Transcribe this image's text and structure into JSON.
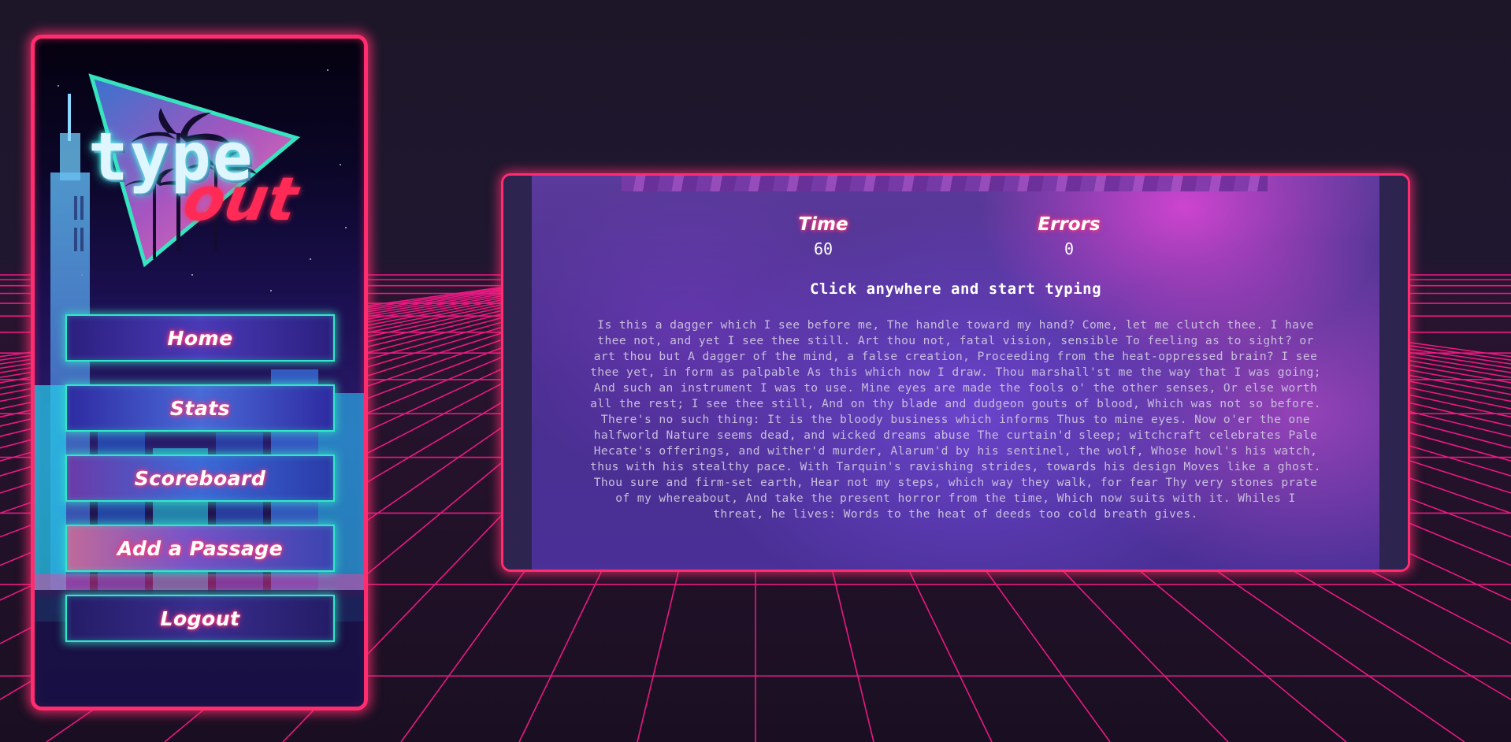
{
  "logo": {
    "word1": "type",
    "word2": "out"
  },
  "nav": {
    "items": [
      {
        "label": "Home"
      },
      {
        "label": "Stats"
      },
      {
        "label": "Scoreboard"
      },
      {
        "label": "Add a Passage"
      },
      {
        "label": "Logout"
      }
    ]
  },
  "stats": {
    "time_label": "Time",
    "time_value": "60",
    "errors_label": "Errors",
    "errors_value": "0"
  },
  "prompt": "Click anywhere and start typing",
  "passage": "Is this a dagger which I see before me, The handle toward my hand? Come, let me clutch thee. I have thee not, and yet I see thee still. Art thou not, fatal vision, sensible To feeling as to sight? or art thou but A dagger of the mind, a false creation, Proceeding from the heat-oppressed brain? I see thee yet, in form as palpable As this which now I draw. Thou marshall'st me the way that I was going; And such an instrument I was to use. Mine eyes are made the fools o' the other senses, Or else worth all the rest; I see thee still, And on thy blade and dudgeon gouts of blood, Which was not so before. There's no such thing: It is the bloody business which informs Thus to mine eyes. Now o'er the one halfworld Nature seems dead, and wicked dreams abuse The curtain'd sleep; witchcraft celebrates Pale Hecate's offerings, and wither'd murder, Alarum'd by his sentinel, the wolf, Whose howl's his watch, thus with his stealthy pace. With Tarquin's ravishing strides, towards his design Moves like a ghost. Thou sure and firm-set earth, Hear not my steps, which way they walk, for fear Thy very stones prate of my whereabout, And take the present horror from the time, Which now suits with it. Whiles I threat, he lives: Words to the heat of deeds too cold breath gives.",
  "colors": {
    "background": "#1d1628",
    "grid": "#ff1a8c",
    "panel_border": "#ff2d6f",
    "button_border": "#34e6c8",
    "logo_cyan": "#29e3d5",
    "logo_red": "#ff2a55"
  },
  "icons": [
    "palm-tree-icon",
    "triangle-logo-icon"
  ]
}
